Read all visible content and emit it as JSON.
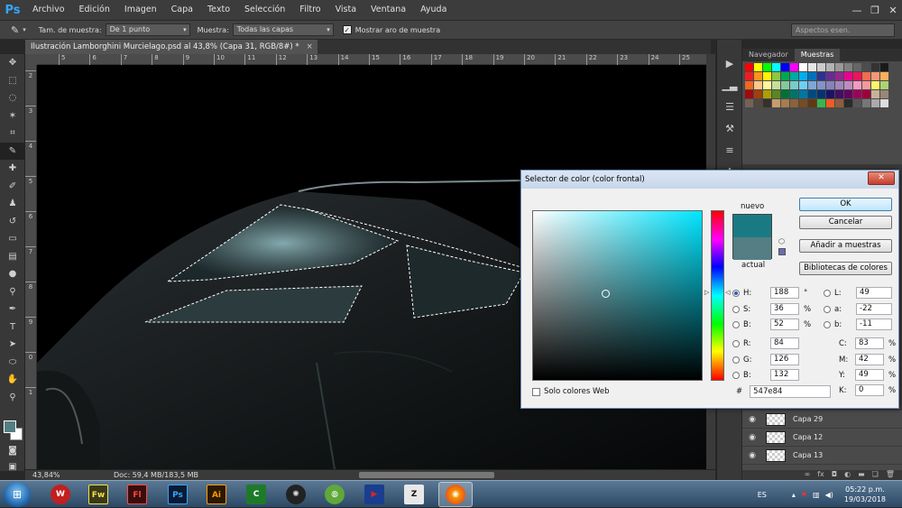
{
  "menubar": {
    "logo": "Ps",
    "items": [
      "Archivo",
      "Edición",
      "Imagen",
      "Capa",
      "Texto",
      "Selección",
      "Filtro",
      "Vista",
      "Ventana",
      "Ayuda"
    ],
    "controls": [
      "—",
      "❐",
      "✕"
    ]
  },
  "options": {
    "sample_size_label": "Tam. de muestra:",
    "sample_size_value": "De 1 punto",
    "sample_label": "Muestra:",
    "sample_value": "Todas las capas",
    "show_ring_label": "Mostrar aro de muestra",
    "workspace": "Aspectos esen."
  },
  "document": {
    "tab_title": "Ilustración Lamborghini Murcielago.psd al 43,8% (Capa 31, RGB/8#) *",
    "ruler_h": [
      "5",
      "6",
      "7",
      "8",
      "9",
      "10",
      "11",
      "12",
      "13",
      "14",
      "15",
      "16",
      "17",
      "18",
      "19",
      "20",
      "21",
      "22",
      "23",
      "24",
      "25"
    ],
    "ruler_v": [
      "2",
      "3",
      "4",
      "5",
      "6",
      "7",
      "8",
      "9",
      "0",
      "1"
    ],
    "zoom": "43,84%",
    "doc_size": "Doc: 59,4 MB/183,5 MB"
  },
  "panels": {
    "tabs": [
      "Navegador",
      "Muestras"
    ],
    "swatch_colors": [
      "#ff0000",
      "#ffff00",
      "#00ff00",
      "#00ffff",
      "#0000ff",
      "#ff00ff",
      "#ffffff",
      "#e6e6e6",
      "#cccccc",
      "#b3b3b3",
      "#999999",
      "#808080",
      "#666666",
      "#4d4d4d",
      "#333333",
      "#1a1a1a",
      "#ed1c24",
      "#f7941d",
      "#fff200",
      "#8dc63f",
      "#00a651",
      "#00a99d",
      "#00aeef",
      "#0072bc",
      "#2e3192",
      "#662d91",
      "#92278f",
      "#ec008c",
      "#ed145b",
      "#f26c4f",
      "#f69679",
      "#fbaf5d",
      "#f26522",
      "#fdc689",
      "#fff799",
      "#c4df9b",
      "#82ca9c",
      "#7accc8",
      "#6dcff6",
      "#7da7d8",
      "#8393ca",
      "#8781bd",
      "#a186be",
      "#bd8cbf",
      "#f49ac1",
      "#f5989d",
      "#fff568",
      "#acd373",
      "#9e0b0f",
      "#a0410d",
      "#aba000",
      "#598527",
      "#007236",
      "#00746b",
      "#0076a3",
      "#004a80",
      "#003471",
      "#1b1464",
      "#440e62",
      "#630460",
      "#9e005d",
      "#9e0039",
      "#c7b299",
      "#998675",
      "#736357",
      "#534741",
      "#37302a",
      "#c69c6d",
      "#a67c52",
      "#8c6239",
      "#754c24",
      "#603913",
      "#39b54a",
      "#f15a24",
      "#8b5e3c",
      "#2b2b2b",
      "#555555",
      "#777777",
      "#aaaaaa",
      "#dddddd"
    ],
    "layers": [
      {
        "name": "Capa 29"
      },
      {
        "name": "Capa 12"
      },
      {
        "name": "Capa 13"
      }
    ]
  },
  "picker": {
    "title": "Selector de color (color frontal)",
    "new_label": "nuevo",
    "current_label": "actual",
    "new_color": "#1a7a84",
    "current_color": "#547e84",
    "buttons": {
      "ok": "OK",
      "cancel": "Cancelar",
      "add": "Añadir a muestras",
      "libraries": "Bibliotecas de colores"
    },
    "hsb": [
      {
        "label": "H:",
        "value": "188",
        "unit": "°"
      },
      {
        "label": "S:",
        "value": "36",
        "unit": "%"
      },
      {
        "label": "B:",
        "value": "52",
        "unit": "%"
      }
    ],
    "rgb": [
      {
        "label": "R:",
        "value": "84"
      },
      {
        "label": "G:",
        "value": "126"
      },
      {
        "label": "B:",
        "value": "132"
      }
    ],
    "lab": [
      {
        "label": "L:",
        "value": "49"
      },
      {
        "label": "a:",
        "value": "-22"
      },
      {
        "label": "b:",
        "value": "-11"
      }
    ],
    "cmyk": [
      {
        "label": "C:",
        "value": "83",
        "unit": "%"
      },
      {
        "label": "M:",
        "value": "42",
        "unit": "%"
      },
      {
        "label": "Y:",
        "value": "49",
        "unit": "%"
      },
      {
        "label": "K:",
        "value": "0",
        "unit": "%"
      }
    ],
    "hex_label": "#",
    "hex": "547e84",
    "web_only_label": "Solo colores Web"
  },
  "taskbar": {
    "apps": [
      "Fw",
      "Fl",
      "Ps",
      "Ai"
    ],
    "lang": "ES",
    "time": "05:22 p.m.",
    "date": "19/03/2018"
  }
}
